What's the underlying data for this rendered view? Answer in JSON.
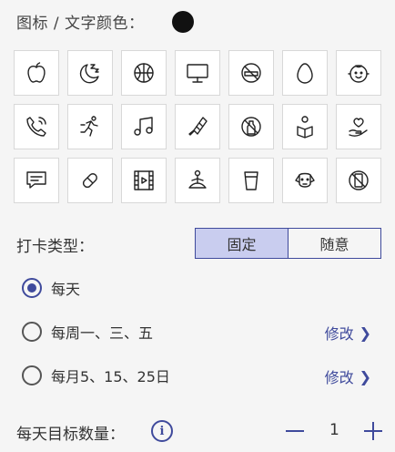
{
  "color_section": {
    "label": "图标 / 文字颜色：",
    "selected_color": "#111111"
  },
  "icons": [
    "apple-icon",
    "moon-sleep-icon",
    "ball-icon",
    "monitor-icon",
    "no-smoking-icon",
    "egg-icon",
    "baby-icon",
    "phone-icon",
    "running-icon",
    "music-icon",
    "badminton-icon",
    "no-drinking-icon",
    "reading-icon",
    "heart-hand-icon",
    "chat-icon",
    "pill-icon",
    "video-icon",
    "meditation-icon",
    "cup-icon",
    "dog-icon",
    "no-phone-icon"
  ],
  "checkin_type": {
    "label": "打卡类型：",
    "options": [
      "固定",
      "随意"
    ],
    "selected": "固定"
  },
  "frequency": [
    {
      "text": "每天",
      "selected": true
    },
    {
      "text": "每周一、三、五",
      "selected": false,
      "action": "修改"
    },
    {
      "text": "每月5、15、25日",
      "selected": false,
      "action": "修改"
    }
  ],
  "goal": {
    "label": "每天目标数量：",
    "count": "1"
  },
  "accent_color": "#3f4a9c"
}
